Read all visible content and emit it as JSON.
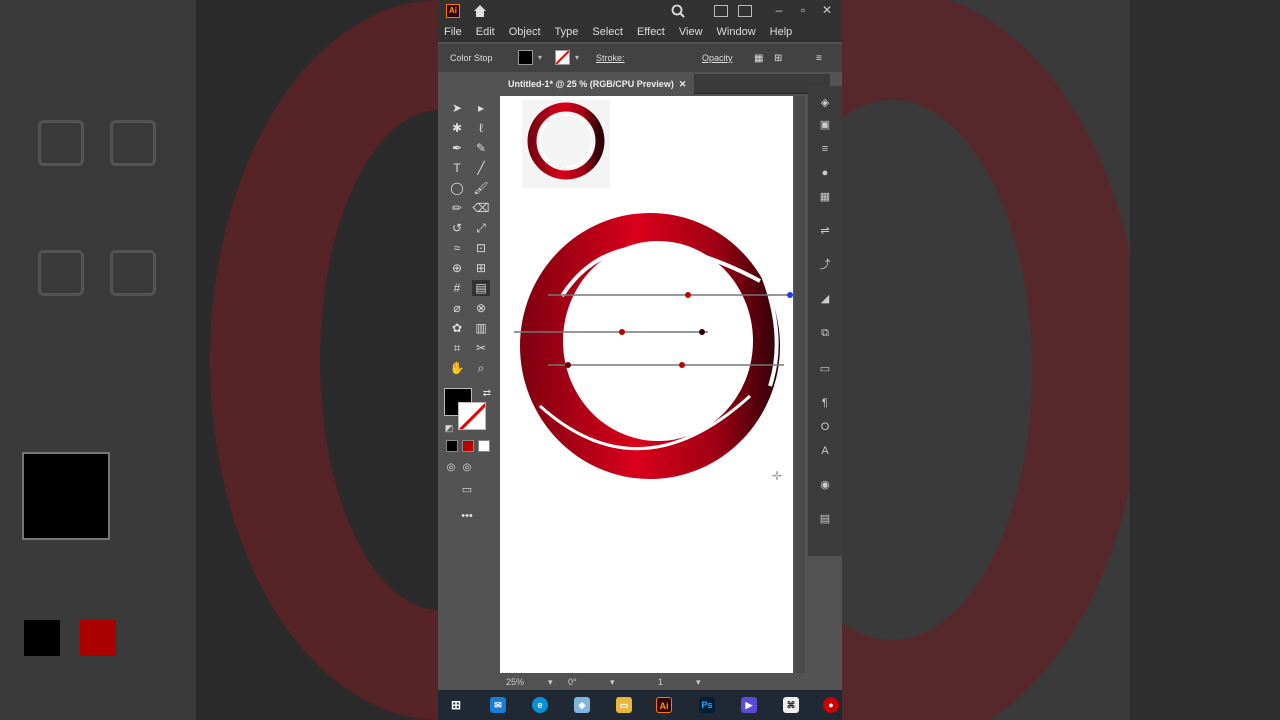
{
  "app": {
    "logo": "Ai"
  },
  "menu": [
    "File",
    "Edit",
    "Object",
    "Type",
    "Select",
    "Effect",
    "View",
    "Window",
    "Help"
  ],
  "control_bar": {
    "label": "Color Stop",
    "stroke_label": "Stroke:",
    "opacity_label": "Opacity"
  },
  "document": {
    "tab_title": "Untitled-1* @ 25 % (RGB/CPU Preview)",
    "tab_close": "✕"
  },
  "status": {
    "zoom": "25%",
    "rotation": "0°",
    "artboard": "1"
  },
  "taskbar": {
    "illustrator": "Ai",
    "photoshop": "Ps"
  },
  "colors": {
    "accent_red": "#b5000f",
    "ui_dark": "#535353",
    "panel": "#323232"
  },
  "icons": [
    "home-icon",
    "search-icon",
    "selection-tool-icon",
    "direct-selection-tool-icon",
    "pen-tool-icon",
    "type-tool-icon",
    "ellipse-tool-icon",
    "brush-tool-icon",
    "eraser-tool-icon",
    "rotate-tool-icon",
    "scale-tool-icon",
    "warp-tool-icon",
    "shape-builder-icon",
    "mesh-tool-icon",
    "gradient-tool-icon",
    "eyedropper-tool-icon",
    "blend-tool-icon",
    "graph-tool-icon",
    "artboard-tool-icon",
    "slice-tool-icon",
    "hand-tool-icon",
    "zoom-tool-icon",
    "layers-icon",
    "properties-icon",
    "windows-start-icon",
    "mail-icon",
    "edge-icon"
  ]
}
